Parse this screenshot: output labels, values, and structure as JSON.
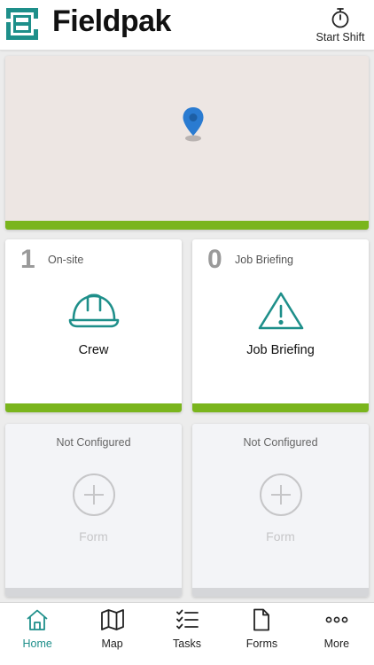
{
  "header": {
    "app_name": "Fieldpak",
    "start_shift_label": "Start Shift"
  },
  "colors": {
    "brand_teal": "#1e8f8a",
    "accent_green": "#7ab51d",
    "map_pin_blue": "#2a7bd1",
    "inactive_gray": "#c6c6c8"
  },
  "map": {
    "pin_icon": "map-pin-icon"
  },
  "tiles": [
    {
      "count": "1",
      "count_label": "On-site",
      "title": "Crew",
      "icon": "hard-hat-icon"
    },
    {
      "count": "0",
      "count_label": "Job Briefing",
      "title": "Job Briefing",
      "icon": "warning-triangle-icon"
    }
  ],
  "unconfigured_tiles": [
    {
      "status": "Not Configured",
      "label": "Form",
      "icon": "add-circle-icon"
    },
    {
      "status": "Not Configured",
      "label": "Form",
      "icon": "add-circle-icon"
    }
  ],
  "nav": {
    "active": "Home",
    "items": [
      {
        "label": "Home",
        "icon": "home-icon"
      },
      {
        "label": "Map",
        "icon": "map-icon"
      },
      {
        "label": "Tasks",
        "icon": "tasks-icon"
      },
      {
        "label": "Forms",
        "icon": "document-icon"
      },
      {
        "label": "More",
        "icon": "more-dots-icon"
      }
    ]
  }
}
